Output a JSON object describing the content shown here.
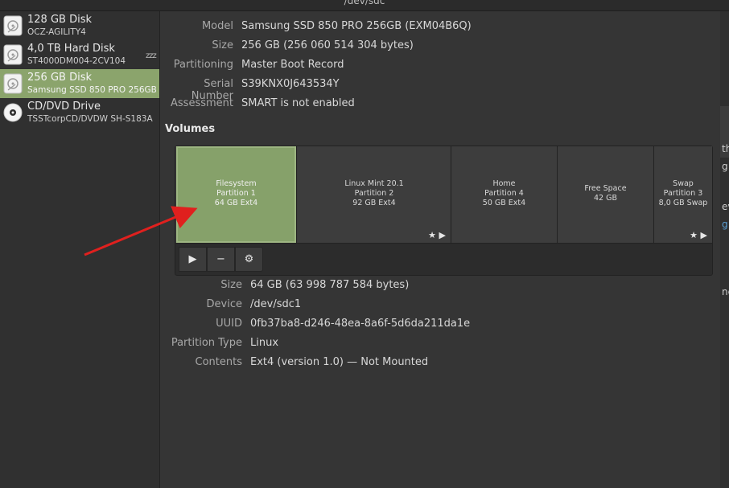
{
  "window": {
    "title": "/dev/sdc"
  },
  "sidebar": {
    "disks": [
      {
        "name": "128 GB Disk",
        "model": "OCZ-AGILITY4",
        "icon": "hard-disk-icon"
      },
      {
        "name": "4,0 TB Hard Disk",
        "model": "ST4000DM004-2CV104",
        "icon": "hard-disk-icon",
        "standby": "zzz"
      },
      {
        "name": "256 GB Disk",
        "model": "Samsung SSD 850 PRO 256GB",
        "icon": "hard-disk-icon"
      },
      {
        "name": "CD/DVD Drive",
        "model": "TSSTcorpCD/DVDW SH-S183A",
        "icon": "optical-disc-icon"
      }
    ]
  },
  "drive": {
    "model": {
      "label": "Model",
      "value": "Samsung SSD 850 PRO 256GB (EXM04B6Q)"
    },
    "size": {
      "label": "Size",
      "value": "256 GB (256 060 514 304 bytes)"
    },
    "partitioning": {
      "label": "Partitioning",
      "value": "Master Boot Record"
    },
    "serial": {
      "label": "Serial Number",
      "value": "S39KNX0J643534Y"
    },
    "assessment": {
      "label": "Assessment",
      "value": "SMART is not enabled"
    }
  },
  "volumes": {
    "heading": "Volumes",
    "partitions": [
      {
        "line1": "Filesystem",
        "line2": "Partition 1",
        "line3": "64 GB Ext4",
        "selected": true
      },
      {
        "line1": "Linux Mint 20.1",
        "line2": "Partition 2",
        "line3": "92 GB Ext4",
        "marks": "★ ▶"
      },
      {
        "line1": "Home",
        "line2": "Partition 4",
        "line3": "50 GB Ext4"
      },
      {
        "line1": "Free Space",
        "line2": "42 GB"
      },
      {
        "line1": "Swap",
        "line2": "Partition 3",
        "line3": "8,0 GB Swap",
        "marks": "★ ▶"
      }
    ],
    "toolbar": {
      "mount": "▶",
      "delete": "−",
      "settings": "⚙"
    }
  },
  "partition_details": {
    "size": {
      "label": "Size",
      "value": "64 GB (63 998 787 584 bytes)"
    },
    "device": {
      "label": "Device",
      "value": "/dev/sdc1"
    },
    "uuid": {
      "label": "UUID",
      "value": "0fb37ba8-d246-48ea-8a6f-5d6da211da1e"
    },
    "type": {
      "label": "Partition Type",
      "value": "Linux"
    },
    "contents": {
      "label": "Contents",
      "value": "Ext4 (version 1.0) — Not Mounted"
    }
  },
  "background_window": {
    "chars": [
      "th",
      "g",
      "ev",
      "g",
      "ne"
    ]
  },
  "colors": {
    "accent": "#8ba46c",
    "arrow": "#e0201e",
    "link": "#5a9fd4"
  }
}
